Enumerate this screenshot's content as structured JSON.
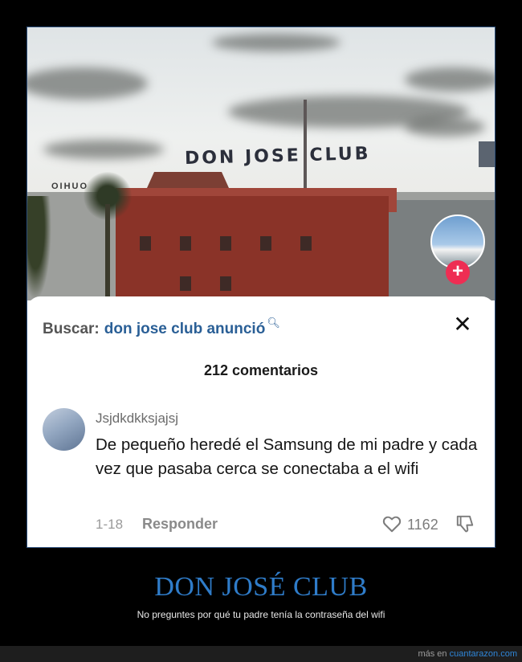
{
  "scene": {
    "sign_text": "DON JOSE CLUB",
    "left_sign_text": "OIHUO"
  },
  "sheet": {
    "search_label": "Buscar:",
    "search_query": "don jose club anunció",
    "comment_count": "212 comentarios",
    "comment": {
      "username": "Jsjdkdkksjajsj",
      "text": "De pequeño heredé el Samsung de mi padre y cada vez que pasaba cerca se conectaba a el wifi",
      "date": "1-18",
      "reply_label": "Responder",
      "likes": "1162"
    }
  },
  "caption": {
    "title": "DON JOSÉ CLUB",
    "subtitle": "No preguntes por qué tu padre tenía la contraseña del wifi"
  },
  "footer": {
    "prefix": "más en",
    "site": "cuantarazon.com"
  },
  "colors": {
    "title_blue": "#2f7cc9",
    "query_blue": "#2a5f96",
    "plus_red": "#ee2d53"
  },
  "icons": [
    "search-icon",
    "close-icon",
    "heart-icon",
    "dislike-icon",
    "plus-icon"
  ]
}
